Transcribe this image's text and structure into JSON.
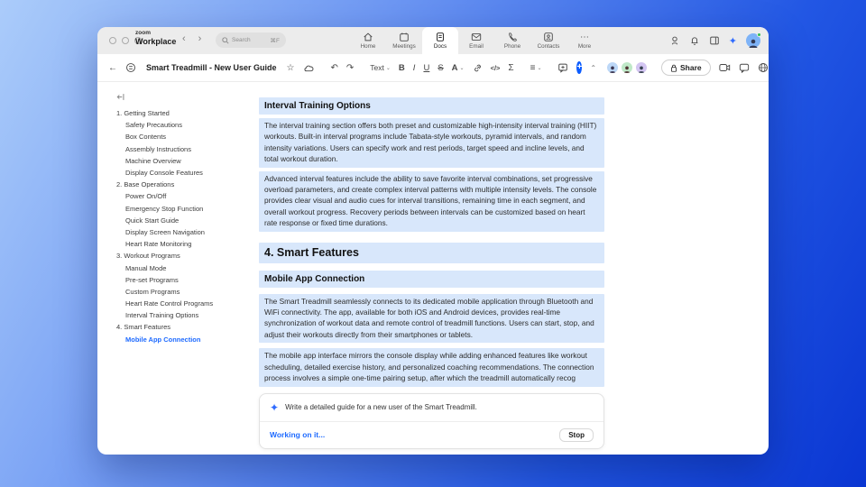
{
  "colors": {
    "accent_blue": "#0B5CFF",
    "highlight": "#D8E7FB",
    "active_link": "#1F6BFF",
    "background_top": "#ABCCFA",
    "background_bottom": "#0A36D2"
  },
  "titlebar": {
    "logo_top": "zoom",
    "logo_bottom": "Workplace",
    "nav_back": "‹",
    "nav_forward": "›",
    "search": {
      "placeholder": "Search",
      "shortcut": "⌘F"
    },
    "tabs": [
      {
        "label": "Home"
      },
      {
        "label": "Meetings"
      },
      {
        "label": "Docs",
        "active": true
      },
      {
        "label": "Email"
      },
      {
        "label": "Phone"
      },
      {
        "label": "Contacts"
      },
      {
        "label": "More"
      }
    ]
  },
  "toolbar": {
    "back": "←",
    "title": "Smart Treadmill - New User Guide",
    "star": "☆",
    "undo": "↶",
    "redo": "↷",
    "text_style": "Text",
    "bold": "B",
    "italic": "I",
    "underline": "U",
    "strike": "S",
    "font_color": "A",
    "code": "</>",
    "formula": "Σ",
    "align": "≡",
    "chevron_down": "⌄",
    "collapse_caret": "⌃",
    "plus": "+",
    "share": "Share",
    "more": "⋯"
  },
  "sidebar": {
    "collapse_icon": "toc-collapse",
    "items": [
      {
        "label": "1. Getting Started",
        "level": 1
      },
      {
        "label": "Safety Precautions",
        "level": 2
      },
      {
        "label": "Box Contents",
        "level": 2
      },
      {
        "label": "Assembly Instructions",
        "level": 2
      },
      {
        "label": "Machine Overview",
        "level": 2
      },
      {
        "label": "Display Console Features",
        "level": 2
      },
      {
        "label": "2. Base Operations",
        "level": 1
      },
      {
        "label": "Power On/Off",
        "level": 2
      },
      {
        "label": "Emergency Stop Function",
        "level": 2
      },
      {
        "label": "Quick Start Guide",
        "level": 2
      },
      {
        "label": "Display Screen Navigation",
        "level": 2
      },
      {
        "label": "Heart Rate Monitoring",
        "level": 2
      },
      {
        "label": "3. Workout Programs",
        "level": 1
      },
      {
        "label": "Manual Mode",
        "level": 2
      },
      {
        "label": "Pre-set Programs",
        "level": 2
      },
      {
        "label": "Custom Programs",
        "level": 2
      },
      {
        "label": "Heart Rate Control Programs",
        "level": 2
      },
      {
        "label": "Interval Training Options",
        "level": 2
      },
      {
        "label": "4. Smart Features",
        "level": 1
      },
      {
        "label": "Mobile App Connection",
        "level": 2,
        "active": true
      }
    ]
  },
  "document": {
    "h2_interval": "Interval Training Options",
    "p1": "The interval training section offers both preset and customizable high-intensity interval training (HIIT) workouts. Built-in interval programs include Tabata-style workouts, pyramid intervals, and random intensity variations. Users can specify work and rest periods, target speed and incline levels, and total workout duration.",
    "p2": "Advanced interval features include the ability to save favorite interval combinations, set progressive overload parameters, and create complex interval patterns with multiple intensity levels. The console provides clear visual and audio cues for interval transitions, remaining time in each segment, and overall workout progress. Recovery periods between intervals can be customized based on heart rate response or fixed time durations.",
    "h1_smart": "4. Smart Features",
    "h2_mobile": "Mobile App Connection",
    "p3": "The Smart Treadmill seamlessly connects to its dedicated mobile application through Bluetooth and WiFi connectivity. The app, available for both iOS and Android devices, provides real-time synchronization of workout data and remote control of treadmill functions. Users can start, stop, and adjust their workouts directly from their smartphones or tablets.",
    "p4": "The mobile app interface mirrors the console display while adding enhanced features like workout scheduling, detailed exercise history, and personalized coaching recommendations. The connection process involves a simple one-time pairing setup, after which the treadmill automatically recog"
  },
  "ai_panel": {
    "sparkle": "✦",
    "prompt": "Write a detailed guide for a new user of the Smart Treadmill.",
    "status": "Working on it...",
    "stop_label": "Stop"
  }
}
